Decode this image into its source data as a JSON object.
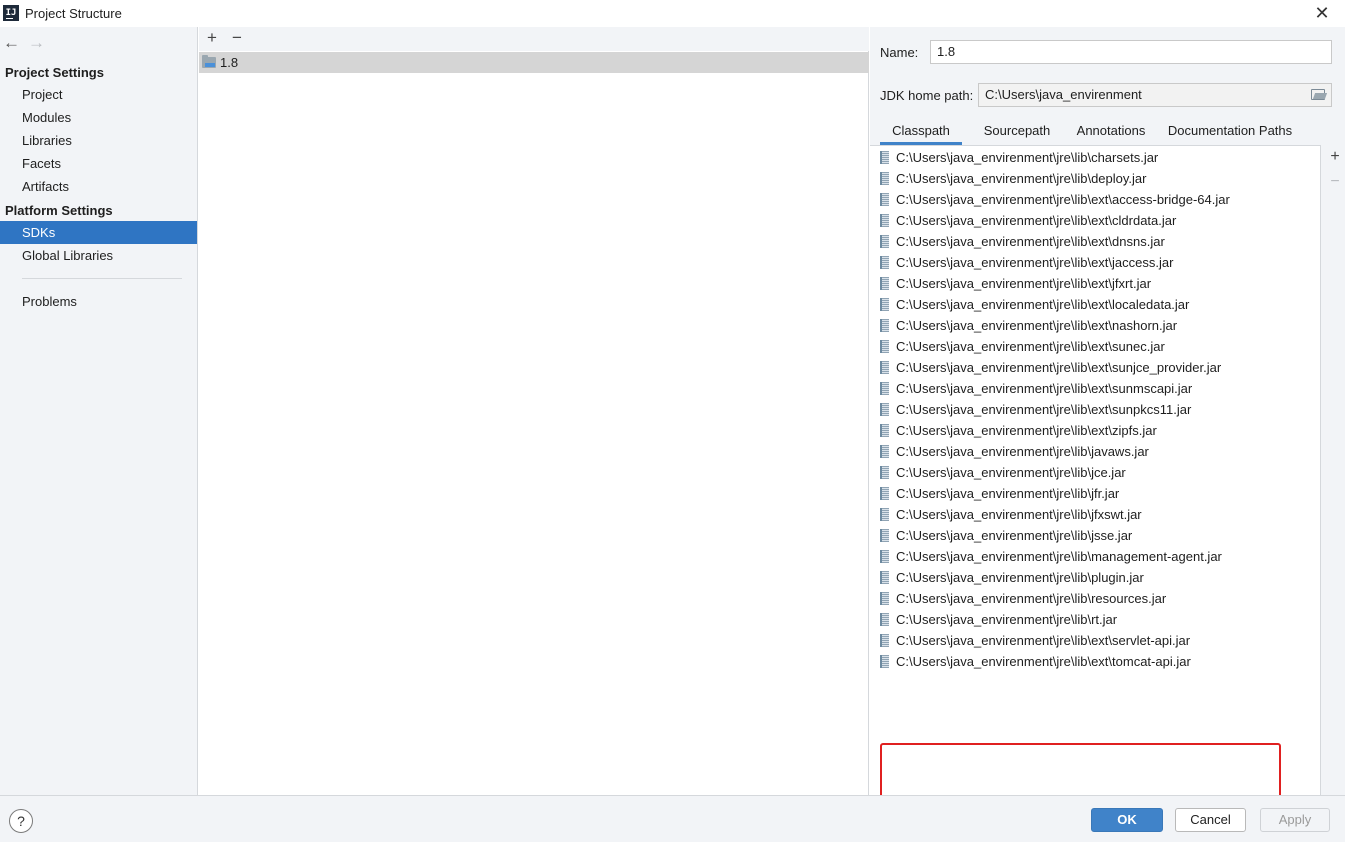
{
  "window": {
    "title": "Project Structure",
    "close_label": "✕"
  },
  "nav": {
    "back": "←",
    "forward": "→"
  },
  "sidebar": {
    "project_settings_heading": "Project Settings",
    "project_settings_items": [
      {
        "label": "Project"
      },
      {
        "label": "Modules"
      },
      {
        "label": "Libraries"
      },
      {
        "label": "Facets"
      },
      {
        "label": "Artifacts"
      }
    ],
    "platform_settings_heading": "Platform Settings",
    "platform_settings_items": [
      {
        "label": "SDKs",
        "selected": true
      },
      {
        "label": "Global Libraries"
      }
    ],
    "problems_label": "Problems"
  },
  "middle": {
    "add_label": "+",
    "remove_label": "−",
    "sdks": [
      {
        "label": "1.8"
      }
    ]
  },
  "details": {
    "name_label": "Name:",
    "name_value": "1.8",
    "jdk_home_label": "JDK home path:",
    "jdk_home_value": "C:\\Users\\java_envirenment",
    "tabs": [
      {
        "label": "Classpath",
        "active": true
      },
      {
        "label": "Sourcepath"
      },
      {
        "label": "Annotations"
      },
      {
        "label": "Documentation Paths"
      }
    ],
    "add_label": "+",
    "remove_label": "−",
    "classpath": [
      "C:\\Users\\java_envirenment\\jre\\lib\\charsets.jar",
      "C:\\Users\\java_envirenment\\jre\\lib\\deploy.jar",
      "C:\\Users\\java_envirenment\\jre\\lib\\ext\\access-bridge-64.jar",
      "C:\\Users\\java_envirenment\\jre\\lib\\ext\\cldrdata.jar",
      "C:\\Users\\java_envirenment\\jre\\lib\\ext\\dnsns.jar",
      "C:\\Users\\java_envirenment\\jre\\lib\\ext\\jaccess.jar",
      "C:\\Users\\java_envirenment\\jre\\lib\\ext\\jfxrt.jar",
      "C:\\Users\\java_envirenment\\jre\\lib\\ext\\localedata.jar",
      "C:\\Users\\java_envirenment\\jre\\lib\\ext\\nashorn.jar",
      "C:\\Users\\java_envirenment\\jre\\lib\\ext\\sunec.jar",
      "C:\\Users\\java_envirenment\\jre\\lib\\ext\\sunjce_provider.jar",
      "C:\\Users\\java_envirenment\\jre\\lib\\ext\\sunmscapi.jar",
      "C:\\Users\\java_envirenment\\jre\\lib\\ext\\sunpkcs11.jar",
      "C:\\Users\\java_envirenment\\jre\\lib\\ext\\zipfs.jar",
      "C:\\Users\\java_envirenment\\jre\\lib\\javaws.jar",
      "C:\\Users\\java_envirenment\\jre\\lib\\jce.jar",
      "C:\\Users\\java_envirenment\\jre\\lib\\jfr.jar",
      "C:\\Users\\java_envirenment\\jre\\lib\\jfxswt.jar",
      "C:\\Users\\java_envirenment\\jre\\lib\\jsse.jar",
      "C:\\Users\\java_envirenment\\jre\\lib\\management-agent.jar",
      "C:\\Users\\java_envirenment\\jre\\lib\\plugin.jar",
      "C:\\Users\\java_envirenment\\jre\\lib\\resources.jar",
      "C:\\Users\\java_envirenment\\jre\\lib\\rt.jar",
      "C:\\Users\\java_envirenment\\jre\\lib\\ext\\servlet-api.jar",
      "C:\\Users\\java_envirenment\\jre\\lib\\ext\\tomcat-api.jar"
    ],
    "highlight_color": "#e02020"
  },
  "footer": {
    "help_label": "?",
    "ok_label": "OK",
    "cancel_label": "Cancel",
    "apply_label": "Apply"
  },
  "colors": {
    "accent": "#2f75c3",
    "ok_button": "#4083c9",
    "panel_bg": "#f2f4f7"
  }
}
